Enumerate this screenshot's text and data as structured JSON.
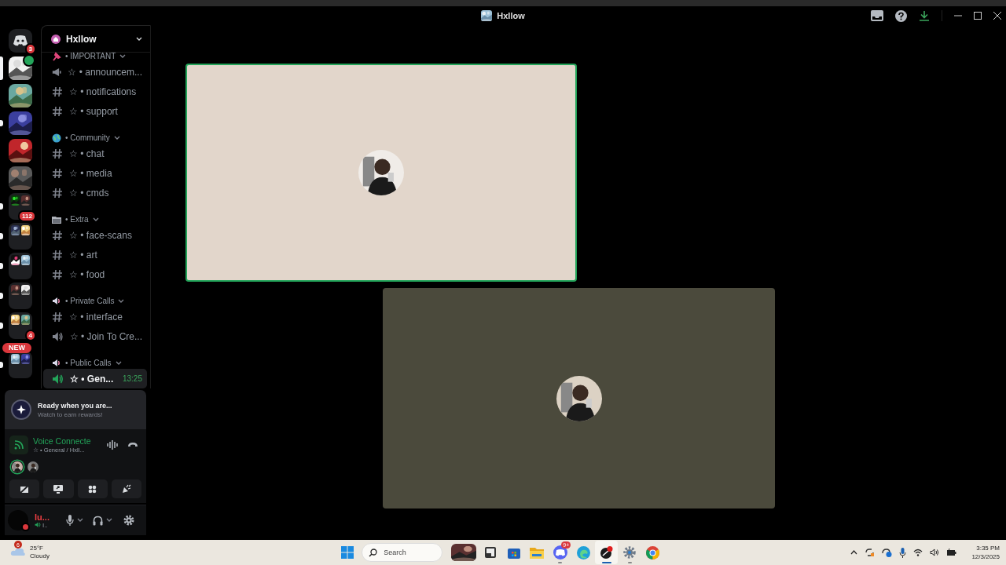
{
  "window": {
    "title": "Hxllow"
  },
  "servers": [
    {
      "kind": "home",
      "badge": "3",
      "selected": false,
      "unread": false
    },
    {
      "kind": "picture",
      "voice": true,
      "selected": true
    },
    {
      "kind": "picture",
      "voice": false,
      "selected": false,
      "unread": false
    },
    {
      "kind": "picture",
      "voice": false,
      "selected": false,
      "unread": true
    },
    {
      "kind": "picture",
      "voice": false,
      "selected": false,
      "unread": false
    },
    {
      "kind": "picture",
      "voice": false,
      "selected": false,
      "unread": false
    },
    {
      "kind": "folder",
      "badge": "112",
      "selected": false,
      "unread": true
    },
    {
      "kind": "folder",
      "selected": false,
      "unread": true
    },
    {
      "kind": "folder",
      "selected": false,
      "unread": true
    },
    {
      "kind": "folder",
      "selected": false,
      "unread": true
    },
    {
      "kind": "folder",
      "badge": "4",
      "selected": false,
      "unread": true
    },
    {
      "kind": "folder",
      "badge": "NEW",
      "selected": false,
      "unread": true
    }
  ],
  "server_header": {
    "name": "Hxllow"
  },
  "categories": [
    {
      "kind": "pin",
      "name": "• IMPORTANT",
      "channels": [
        {
          "kind": "announcement",
          "name": "☆ • announcem...",
          "selected": false
        },
        {
          "kind": "text",
          "name": "☆ • notifications",
          "selected": false
        },
        {
          "kind": "text",
          "name": "☆ • support",
          "selected": false
        }
      ]
    },
    {
      "kind": "globe",
      "name": "• Community",
      "channels": [
        {
          "kind": "text",
          "name": "☆ • chat",
          "selected": false
        },
        {
          "kind": "text",
          "name": "☆ • media",
          "selected": false
        },
        {
          "kind": "text",
          "name": "☆ • cmds",
          "selected": false
        }
      ]
    },
    {
      "kind": "folder",
      "name": "• Extra",
      "channels": [
        {
          "kind": "text",
          "name": "☆ • face-scans",
          "selected": false
        },
        {
          "kind": "text",
          "name": "☆ • art",
          "selected": false
        },
        {
          "kind": "text",
          "name": "☆ • food",
          "selected": false
        }
      ]
    },
    {
      "kind": "speaker",
      "name": "• Private Calls",
      "channels": [
        {
          "kind": "text",
          "name": "☆ • interface",
          "selected": false
        },
        {
          "kind": "voice",
          "name": "☆ • Join To Cre...",
          "selected": false
        }
      ]
    },
    {
      "kind": "speaker",
      "name": "• Public Calls",
      "channels": [
        {
          "kind": "voice",
          "name": "☆ • Gen...",
          "selected": true,
          "timer": "13:25"
        }
      ]
    }
  ],
  "rewards": {
    "title": "Ready when you are...",
    "subtitle": "Watch to earn rewards!"
  },
  "voice": {
    "status": "Voice Connecte",
    "channel": "☆ • General / Hxll...",
    "participants": [
      {
        "speaking": true
      },
      {
        "speaking": false
      }
    ]
  },
  "user": {
    "name": "lu...",
    "status": "I.."
  },
  "tiles": [
    {
      "color": "#e2d6cb",
      "speaking": true
    },
    {
      "color": "#4b4a3c",
      "speaking": false
    }
  ],
  "taskbar": {
    "weather": {
      "badge": "6",
      "temperature": "25°F",
      "condition": "Cloudy"
    },
    "search": {
      "placeholder": "Search"
    },
    "apps": [
      {
        "kind": "picture",
        "running": false,
        "active": false
      },
      {
        "kind": "terminal",
        "running": false,
        "active": false
      },
      {
        "kind": "store",
        "running": false,
        "active": false
      },
      {
        "kind": "folder",
        "running": false,
        "active": false
      },
      {
        "kind": "chat",
        "badge": "9+",
        "running": true,
        "active": false
      },
      {
        "kind": "browser",
        "running": false,
        "active": false
      },
      {
        "kind": "editor",
        "running": true,
        "active": true
      },
      {
        "kind": "settings",
        "running": true,
        "active": false
      },
      {
        "kind": "chrome",
        "running": false,
        "active": false
      }
    ],
    "time": "3:35 PM",
    "date": "12/3/2025"
  }
}
